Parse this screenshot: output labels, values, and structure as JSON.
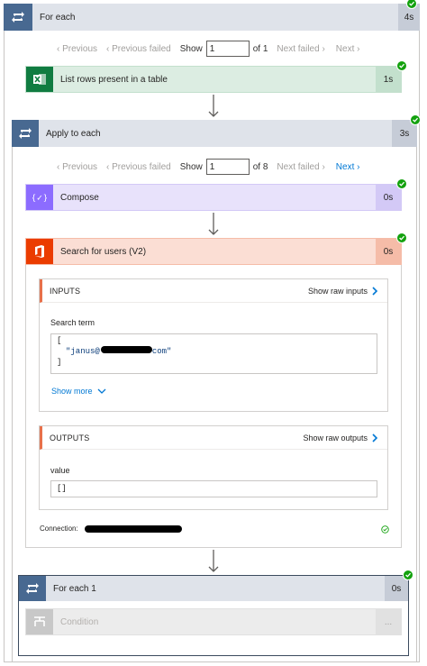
{
  "for_each": {
    "title": "For each",
    "duration": "4s"
  },
  "pager_outer": {
    "previous": "Previous",
    "previous_failed": "Previous failed",
    "show": "Show",
    "value": "1",
    "of": "of 1",
    "next_failed": "Next failed",
    "next": "Next"
  },
  "list_rows": {
    "title": "List rows present in a table",
    "duration": "1s"
  },
  "apply_each": {
    "title": "Apply to each",
    "duration": "3s"
  },
  "pager_inner": {
    "previous": "Previous",
    "previous_failed": "Previous failed",
    "show": "Show",
    "value": "1",
    "of": "of 8",
    "next_failed": "Next failed",
    "next": "Next"
  },
  "compose": {
    "title": "Compose",
    "duration": "0s"
  },
  "search_users": {
    "title": "Search for users (V2)",
    "duration": "0s",
    "inputs": {
      "header": "INPUTS",
      "show_raw": "Show raw inputs",
      "label": "Search term",
      "open_bracket": "[",
      "value_prefix": "\"janus@",
      "value_suffix": "com\"",
      "close_bracket": "]",
      "show_more": "Show more"
    },
    "outputs": {
      "header": "OUTPUTS",
      "show_raw": "Show raw outputs",
      "label": "value",
      "value": "[]"
    },
    "connection_label": "Connection:"
  },
  "for_each_1": {
    "title": "For each 1",
    "duration": "0s"
  },
  "condition": {
    "title": "Condition",
    "more": "..."
  },
  "colors": {
    "loop_header": "#dfe3ea",
    "loop_icon_bg": "#486991",
    "excel_header": "#dcede2",
    "excel_dur": "#c3e0cd",
    "compose_header": "#e8e2fb",
    "compose_dur": "#d3c9f6",
    "office_header": "#fbded4",
    "office_dur": "#f5bca8",
    "success": "#13a10e",
    "link": "#0078d4"
  }
}
